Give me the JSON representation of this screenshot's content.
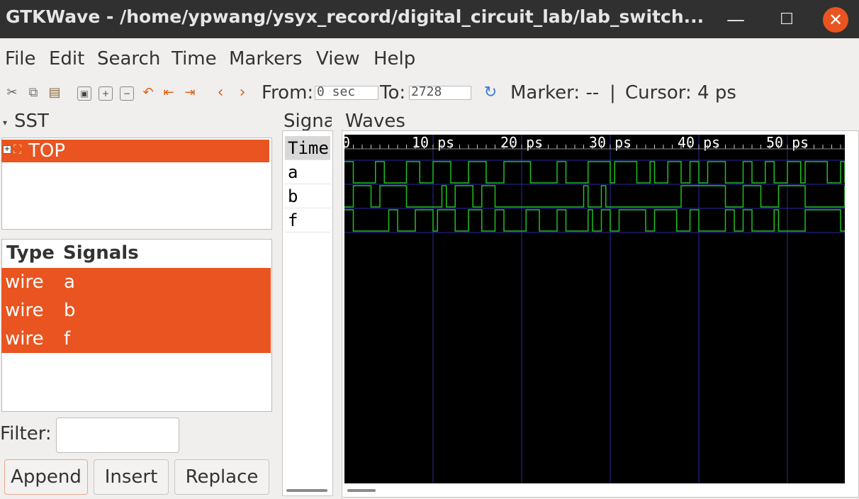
{
  "window": {
    "title": "GTKWave - /home/ypwang/ysyx_record/digital_circuit_lab/lab_switch...",
    "minimize": "—",
    "maximize": "☐",
    "close": "✕"
  },
  "menu": [
    "File",
    "Edit",
    "Search",
    "Time",
    "Markers",
    "View",
    "Help"
  ],
  "toolbar": {
    "from_label": "From:",
    "from_value": "0 sec",
    "to_label": "To:",
    "to_value": "2728",
    "marker_text": "Marker: --",
    "separator": "|",
    "cursor_text": "Cursor: 4 ps",
    "icons": [
      "cut-icon",
      "copy-icon",
      "paste-icon",
      "zoom-fit-icon",
      "zoom-in-icon",
      "zoom-out-icon",
      "undo-zoom-icon",
      "zoom-to-start-icon",
      "zoom-to-end-icon",
      "prev-edge-icon",
      "next-edge-icon",
      "reload-icon"
    ]
  },
  "sst": {
    "label": "SST",
    "tree": [
      {
        "name": "TOP",
        "expander": "+"
      }
    ],
    "signals_header": {
      "type": "Type",
      "signals": "Signals"
    },
    "signals": [
      {
        "type": "wire",
        "name": "a"
      },
      {
        "type": "wire",
        "name": "b"
      },
      {
        "type": "wire",
        "name": "f"
      }
    ],
    "filter_label": "Filter:",
    "filter_value": "",
    "buttons": {
      "append": "Append",
      "insert": "Insert",
      "replace": "Replace"
    }
  },
  "signals_pane": {
    "label": "Signa",
    "rows": [
      "Time",
      "a",
      "b",
      "f"
    ]
  },
  "waves": {
    "label": "Waves",
    "time_labels": [
      "0",
      "10 ps",
      "20 ps",
      "30 ps",
      "40 ps",
      "50 ps"
    ],
    "time_unit_ps_per_major": 10,
    "visible_range_ps": [
      0,
      56.5
    ],
    "colors": {
      "background": "#000000",
      "wave": "#20c020",
      "grid": "#2a2aa0",
      "text": "#ffffff"
    },
    "signals": [
      {
        "name": "a",
        "initial": 1,
        "toggles_ps": [
          1.0,
          3.5,
          4.5,
          7.0,
          8.5,
          10.0,
          12.0,
          14.0,
          16.0,
          18.0,
          21.0,
          24.0,
          25.0,
          27.5,
          30.0,
          30.5,
          33.0,
          34.5,
          35.0,
          36.5,
          38.0,
          39.0,
          40.0,
          41.0,
          43.0,
          45.0,
          46.0,
          47.5,
          48.5,
          50.0,
          51.5,
          52.0,
          54.5,
          56.0,
          56.5
        ]
      },
      {
        "name": "b",
        "initial": 0,
        "toggles_ps": [
          1.0,
          3.0,
          4.0,
          7.0,
          11.0,
          11.5,
          12.5,
          14.5,
          15.5,
          17.0,
          27.0,
          27.5,
          29.0,
          29.5,
          38.0,
          43.0,
          45.0,
          47.0,
          49.0,
          52.0,
          56.5
        ]
      },
      {
        "name": "f",
        "initial": 1,
        "toggles_ps": [
          1.0,
          5.0,
          6.0,
          8.0,
          10.0,
          10.5,
          12.5,
          14.0,
          15.5,
          17.0,
          18.0,
          20.5,
          22.0,
          24.0,
          25.0,
          27.5,
          28.0,
          29.0,
          30.0,
          31.0,
          34.0,
          35.0,
          37.5,
          39.0,
          40.0,
          43.0,
          44.0,
          45.0,
          46.0,
          48.5,
          49.0,
          52.0,
          56.0
        ]
      }
    ]
  }
}
